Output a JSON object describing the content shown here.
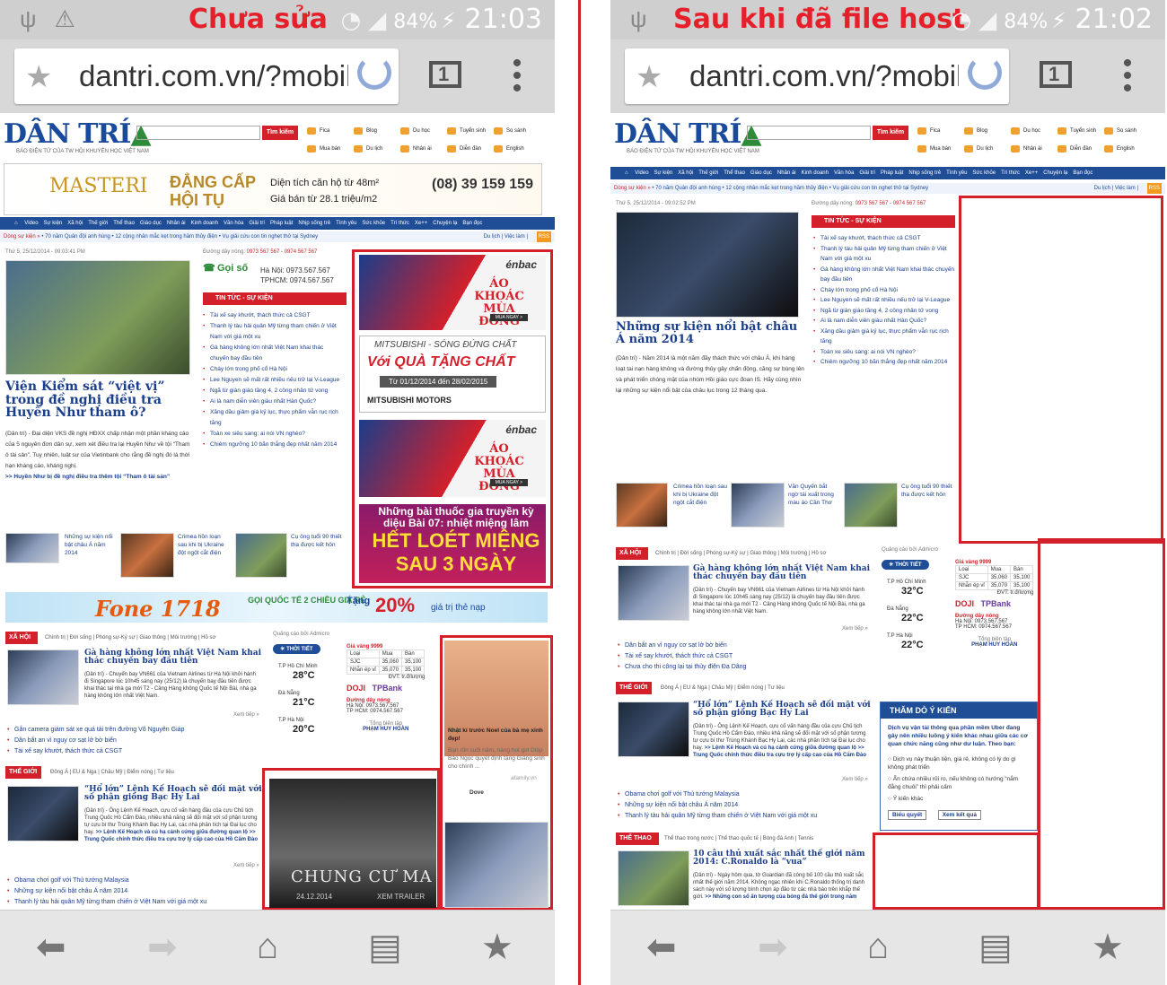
{
  "left": {
    "label": "Chưa sửa",
    "status": {
      "battery": "84%",
      "time": "21:03"
    },
    "url": "dantri.com.vn/?mobile",
    "tab_count": "1"
  },
  "right": {
    "label": "Sau khi đã file host",
    "status": {
      "battery": "84%",
      "time": "21:02"
    },
    "url": "dantri.com.vn/?mobile",
    "tab_count": "1"
  },
  "site": {
    "logo": "DÂN TRÍ",
    "slogan": "BÁO ĐIỆN TỬ CỦA TW HỘI KHUYẾN HỌC VIỆT NAM",
    "search_button": "Tìm kiếm",
    "quick_links": [
      "Fica",
      "Blog",
      "Du học",
      "Tuyển sinh",
      "So sánh",
      "Mua bán",
      "Du lịch",
      "Nhân ái",
      "Diễn đàn",
      "English"
    ],
    "nav": [
      "Video",
      "Sự kiện",
      "Xã hội",
      "Thế giới",
      "Thể thao",
      "Giáo dục",
      "Nhân ái",
      "Kinh doanh",
      "Văn hóa",
      "Giải trí",
      "Pháp luật",
      "Nhịp sống trẻ",
      "Tình yêu",
      "Sức khỏe",
      "Trí thức",
      "Xe++",
      "Chuyện lạ",
      "Bạn đọc"
    ],
    "ticker": {
      "label": "Dòng sự kiện »",
      "items": "• 70 năm Quân đội anh hùng  • 12 cộng nhân mắc kẹt trong hầm thủy điện  • Vụ giải cứu con tin nghẹt thở tại Sydney",
      "right": "Du lịch | Việc làm |",
      "rss": "RSS"
    },
    "hotline": {
      "label": "Đường dây nóng:",
      "numbers": "0973 567 567 - 0974 567 567"
    },
    "section_tin_tuc": "TIN TỨC - SỰ KIỆN"
  },
  "left_page": {
    "ad_masteri": {
      "brand": "MASTERI",
      "slogan": "ĐẲNG CẤP HỘI TỤ",
      "l1": "Diện tích căn hộ từ 48m²",
      "l2": "Giá bán từ 28.1 triệu/m2",
      "phone": "(08) 39 159 159"
    },
    "date": "Thứ 5, 25/12/2014 - 09:03:41 PM",
    "headline": "Viện Kiểm sát “việt vị” trong đề nghị điều tra Huyền Như tham ô?",
    "lead": "(Dân trí) - Đại diện VKS đề nghị HĐXX chấp nhận một phần kháng cáo của 5 nguyên đơn dân sự, xem xét điều tra lại Huyền Như về tội “Tham ô tài sản”. Tuy nhiên, luật sư của Vietinbank cho rằng đề nghị đó là thời hạn kháng cáo, kháng nghị.",
    "lead_link": ">> Huyền Như bị đề nghị điều tra thêm tội “Tham ô tài sản”",
    "callbox": {
      "label": "Gọi số",
      "hn": "Hà Nội: 0973.567.567",
      "hcm": "TPHCM: 0974.567.567"
    },
    "news": [
      "Tài xế say khướt, thách thức cả CSGT",
      "Thanh lý tàu hải quân Mỹ từng tham chiến ở Việt Nam với giá một xu",
      "Gà hàng không lớn nhất Việt Nam khai thác chuyến bay đầu tiên",
      "Cháy lớn trong phố cổ Hà Nội",
      "Lee Nguyen sẽ mất rất nhiều nếu trở lại V-League",
      "Ngã từ giàn giáo tầng 4, 2 công nhân tử vong",
      "Ai là nam diễn viên giàu nhất Hàn Quốc?",
      "Xăng dầu giảm giá kỷ lục, thực phẩm vẫn rục rịch tăng",
      "Toàn xe siêu sang: ai nói VN nghèo?",
      "Chiêm ngưỡng 10 bãn thắng đẹp nhất năm 2014"
    ],
    "thumbs": [
      "Những sự kiện nổi bật châu Á năm 2014",
      "Crimea hồn loạn sau khi bị Ukraine đột ngột cắt điện",
      "Cụ ông tuổi 90 thiết tha được kết hôn"
    ],
    "ads": {
      "jacket": {
        "brand": "énbac",
        "title": "ÁO KHOÁC MÙA ĐÔNG",
        "cta": "MUA NGAY >"
      },
      "mitsubishi": {
        "t1": "MITSUBISHI - SÓNG ĐỨNG CHẤT",
        "t2": "Với QUÀ TẶNG CHẤT",
        "t3": "Từ 01/12/2014 đến 28/02/2015",
        "t4": "MITSUBISHI MOTORS"
      },
      "jacket2": {
        "brand": "énbac",
        "title": "ÁO KHOÁC MÙA ĐÔNG",
        "cta": "MUA NGAY >"
      },
      "toothpaste": {
        "t1": "Những bài thuốc gia truyền kỳ diệu Bài 07: nhiệt miệng lâm",
        "t2": "HẾT LOÉT MIỆNG SAU 3 NGÀY"
      },
      "fone": {
        "t1": "Fone 1718",
        "t2": "GỌI QUỐC TẾ 2 CHIỀU GIÁ RẺ",
        "t3": "Tặng",
        "t4": "20%",
        "t5": "giá trị thẻ nạp"
      },
      "family": {
        "caption": "Nhật kí trước Noel của bà mẹ xinh đẹp!",
        "desc": "Bạn rốn cuối năm, nàng hot girl Diệp Bảo Ngọc quyết định tặng Giáng sinh cho chính ...",
        "source": "afamily.vn",
        "brand": "Dove"
      },
      "movie": {
        "title": "CHUNG CƯ MA",
        "date": "24.12.2014",
        "cta": "XEM TRAILER"
      }
    },
    "xa_hoi": {
      "label": "XÃ HỘI",
      "subs": "Chính trị  |  Đời sống  |  Phóng sự-Ký sự  |  Giao thông  |  Môi trường  |  Hồ sơ",
      "headline": "Gà hàng không lớn nhất Việt Nam khai thác chuyến bay đầu tiên",
      "lead": "(Dân trí) - Chuyến bay VN661 của Vietnam Airlines từ Hà Nội khởi hành đi Singapore lúc 10h45 sáng nay (25/12) là chuyến bay đầu tiên được khai thác tại nhà ga mới T2 - Cảng Hàng không Quốc tế Nội Bài, nhà ga hàng không lớn nhất Việt Nam.",
      "more": "Xem tiếp »",
      "list": [
        "Gắn camera giám sát xe quá tải trên đường Võ Nguyên Giáp",
        "Dân bắt an vì nguy cơ sạt lở bờ biển",
        "Tài xế say khướt, thách thức cả CSGT"
      ]
    },
    "the_gioi": {
      "label": "THẾ GIỚI",
      "subs": "Đông Á  |  EU & Nga  |  Châu Mỹ  |  Điểm nóng  |  Tư liệu",
      "headline": "“Hổ lớn” Lệnh Kế Hoạch sẽ đối mặt với số phận giống Bạc Hy Lai",
      "lead": "(Dân trí) - Ông Lệnh Kế Hoạch, cựu cố vấn hàng đầu của cựu Chủ tịch Trung Quốc Hồ Cẩm Đào, nhiều khả năng sẽ đối mặt với số phận tương tự cựu bí thư Trùng Khánh Bạc Hy Lai, các nhà phân tích tại Đại lục cho hay.",
      "links": ">> Lệnh Kế Hoạch và cú hạ cánh cứng giữa đường quan lộ >> Trung Quốc chính thức điều tra cựu trợ lý cấp cao của Hồ Cẩm Đào",
      "more": "Xem tiếp »",
      "list": [
        "Obama chơi golf với Thủ tướng Malaysia",
        "Những sự kiện nổi bật châu Á năm 2014",
        "Thanh lý tàu hải quân Mỹ từng tham chiến ở Việt Nam với giá một xu"
      ]
    },
    "widget": {
      "ad_label": "Quảng cáo bởi Admicro",
      "weather": "THỜI TIẾT",
      "w1": "T.P Hồ Chí Minh",
      "t1": "28°C",
      "w2": "Đà Nẵng",
      "t2": "21°C",
      "w3": "T.P Hà Nội",
      "t3": "20°C",
      "gold": "Giá vàng 9999",
      "g_hdr": [
        "Loại",
        "Mua",
        "Bán"
      ],
      "g1": [
        "SJC",
        "35,060",
        "35,100"
      ],
      "g2": [
        "Nhẫn ép vỉ",
        "35,070",
        "35,100"
      ],
      "unit": "ĐVT: tr.đ/lượng",
      "doji": "DOJI",
      "tpbank": "TPBank",
      "hot": "Đường dây nóng",
      "hn": "Hà Nội: 0973.567.567",
      "hcm": "TP HCM: 0974.567.567",
      "gm": "Tổng biên tập",
      "gm_name": "PHẠM HUY HOÀN"
    }
  },
  "right_page": {
    "date": "Thứ 5, 25/12/2014 - 09:02:52 PM",
    "headline": "Những sự kiện nổi bật châu Á năm 2014",
    "lead": "(Dân trí) - Năm 2014 là một năm đầy thách thức với châu Á, khi hàng loạt tai nạn hàng không và đường thủy gây chấn động, căng sự bùng lên và phát triển chóng mặt của nhóm Hồi giáo cực đoan IS. Hãy cùng nhìn lại những sự kiện nổi bật của châu lục trong 12 tháng qua.",
    "news": [
      "Tài xế say khướt, thách thức cả CSGT",
      "Thanh lý tàu hải quân Mỹ từng tham chiến ở Việt Nam với giá một xu",
      "Gà hàng không lớn nhất Việt Nam khai thác chuyến bay đầu tiên",
      "Cháy lớn trong phố cổ Hà Nội",
      "Lee Nguyen sẽ mất rất nhiều nếu trở lại V-League",
      "Ngã từ giàn giáo tầng 4, 2 công nhân tử vong",
      "Ai là nam diễn viên giàu nhất Hàn Quốc?",
      "Xăng dầu giảm giá kỷ lục, thực phẩm vẫn rục rịch tăng",
      "Toàn xe siêu sang: ai nói VN nghèo?",
      "Chiêm ngưỡng 10 bãn thắng đẹp nhất năm 2014"
    ],
    "thumbs": [
      "Crimea hồn loạn sau khi bị Ukraine đột ngột cắt điện",
      "Văn Quyến bắt ngờ tái xuất trong màu áo Cần Thơ",
      "Cụ ông tuổi 90 thiết tha được kết hôn"
    ],
    "xa_hoi": {
      "label": "XÃ HỘI",
      "subs": "Chính trị  |  Đời sống  |  Phóng sự-Ký sự  |  Giao thông  |  Môi trường  |  Hồ sơ",
      "headline": "Gà hàng không lớn nhất Việt Nam khai thác chuyến bay đầu tiên",
      "lead": "(Dân trí) - Chuyến bay VN661 của Vietnam Airlines từ Hà Nội khởi hành đi Singapore lúc 10h45 sáng nay (25/12) là chuyến bay đầu tiên được khai thác tại nhà ga mới T2 - Cảng Hàng không Quốc tế Nội Bài, nhà ga hàng không lớn nhất Việt Nam.",
      "more": "Xem tiếp »",
      "list": [
        "Dân bắt an vì nguy cơ sạt lở bờ biển",
        "Tài xế say khướt, thách thức cả CSGT",
        "Chưa cho thi công lại tại thủy điện Đạ Dâng"
      ]
    },
    "the_gioi": {
      "label": "THẾ GIỚI",
      "subs": "Đông Á  |  EU & Nga  |  Châu Mỹ  |  Điểm nóng  |  Tư liệu",
      "headline": "“Hổ lớn” Lệnh Kế Hoạch sẽ đối mặt với số phận giống Bạc Hy Lai",
      "lead": "(Dân trí) - Ông Lệnh Kế Hoạch, cựu cố vấn hàng đầu của cựu Chủ tịch Trung Quốc Hồ Cẩm Đào, nhiều khả năng sẽ đối mặt với số phận tương tự cựu bí thư Trùng Khánh Bạc Hy Lai, các nhà phân tích tại Đại lục cho hay.",
      "links": ">> Lệnh Kế Hoạch và cú hạ cánh cứng giữa đường quan lộ >> Trung Quốc chính thức điều tra cựu trợ lý cấp cao của Hồ Cẩm Đào",
      "more": "Xem tiếp »",
      "list": [
        "Obama chơi golf với Thủ tướng Malaysia",
        "Những sự kiện nổi bật châu Á năm 2014",
        "Thanh lý tàu hải quân Mỹ từng tham chiến ở Việt Nam với giá một xu"
      ]
    },
    "the_thao": {
      "label": "THỂ THAO",
      "subs": "Thể thao trong nước  |  Thể thao quốc tế  |  Bóng đá Anh  |  Tennis",
      "headline": "10 câu thủ xuất sắc nhất thế giới năm 2014: C.Ronaldo là “vua”",
      "lead": "(Dân trí) - Ngày hôm qua, tờ Guardian đã công bố 100 cầu thủ xuất sắc nhất thế giới năm 2014. Không ngạc nhiên khi C.Ronaldo thống trị danh sách này với số lượng bình chọn áp đảo từ các nhà báo trên khắp thế giới.",
      "link": ">> Những con số ấn tượng của bóng đá thế giới trong năm"
    },
    "widget": {
      "ad_label": "Quảng cáo bởi Admicro",
      "weather": "THỜI TIẾT",
      "w1": "T.P Hồ Chí Minh",
      "t1": "32°C",
      "w2": "Đà Nẵng",
      "t2": "22°C",
      "w3": "T.P Hà Nội",
      "t3": "22°C",
      "gold": "Giá vàng 9999",
      "g_hdr": [
        "Loại",
        "Mua",
        "Bán"
      ],
      "g1": [
        "SJC",
        "35,060",
        "35,100"
      ],
      "g2": [
        "Nhẫn ép vỉ",
        "35,070",
        "35,100"
      ],
      "unit": "ĐVT: tr.đ/lượng",
      "doji": "DOJI",
      "tpbank": "TPBank",
      "hot": "Đường dây nóng",
      "hn": "Hà Nội: 0973.567.567",
      "hcm": "TP HCM: 0974.567.567",
      "gm": "Tổng biên tập",
      "gm_name": "PHẠM HUY HOÀN"
    },
    "poll": {
      "title": "THĂM DÒ Ý KIẾN",
      "question": "Dịch vụ vận tải thông qua phần mềm Uber đang gây nên nhiều luồng ý kiến khác nhau giữa các cơ quan chức năng cũng như dư luận. Theo bạn:",
      "options": [
        "Dịch vụ này thuận tiện, giá rẻ, không có lý do gì không phát triển",
        "Ẩn chứa nhiều rủi ro, nếu không có hướng “nắm đằng chuôi” thì phải cấm",
        "Ý kiến khác"
      ],
      "vote": "Biểu quyết",
      "results": "Xem kết quả"
    }
  }
}
